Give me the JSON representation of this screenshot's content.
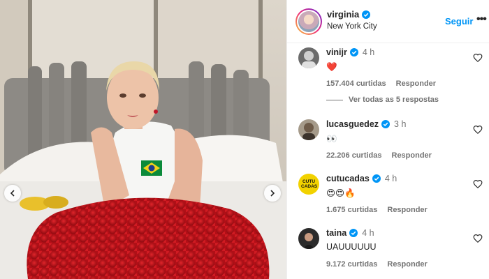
{
  "post_header": {
    "username": "virginia",
    "location": "New York City",
    "follow_label": "Seguir",
    "more_label": "•••"
  },
  "comments": [
    {
      "username": "vinijr",
      "time": "4 h",
      "text": "❤️",
      "likes": "157.404 curtidas",
      "reply_label": "Responder"
    },
    {
      "username": "lucasguedez",
      "time": "3 h",
      "text": "👀",
      "likes": "22.206 curtidas",
      "reply_label": "Responder"
    },
    {
      "username": "cutucadas",
      "time": "4 h",
      "text": "😍😍🔥",
      "likes": "1.675 curtidas",
      "reply_label": "Responder",
      "avatar_text": "CUTU CADAS"
    },
    {
      "username": "taina",
      "time": "4 h",
      "text": "UAUUUUUU",
      "likes": "9.172 curtidas",
      "reply_label": "Responder"
    }
  ],
  "view_replies_label": "Ver todas as 5 respostas",
  "colors": {
    "accent": "#0095f6",
    "verified": "#0095f6",
    "muted": "#737373",
    "roses": "#c8141e"
  },
  "icons": [
    "verified-badge-icon",
    "heart-outline-icon",
    "chevron-left-icon",
    "chevron-right-icon",
    "more-icon"
  ]
}
